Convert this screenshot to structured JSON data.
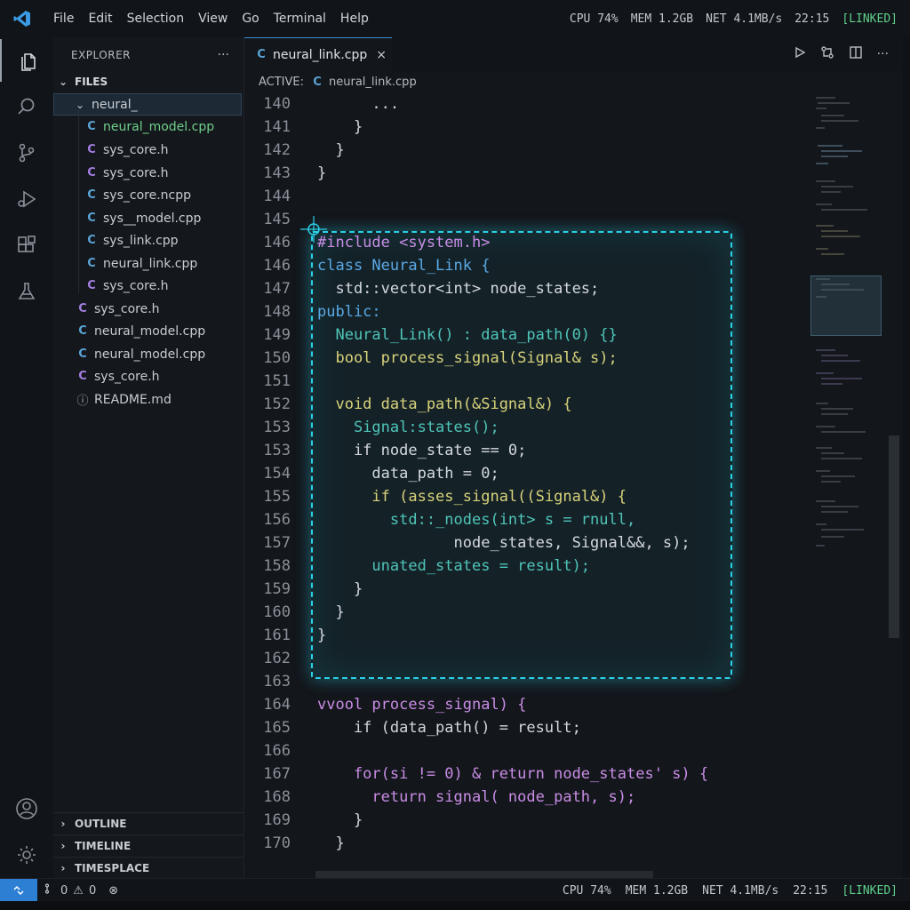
{
  "menubar": {
    "items": [
      "File",
      "Edit",
      "Selection",
      "View",
      "Go",
      "Terminal",
      "Help"
    ]
  },
  "system": {
    "cpu": "CPU 74%",
    "mem": "MEM 1.2GB",
    "net": "NET 4.1MB/s",
    "time": "22:15",
    "link": "[LINKED]"
  },
  "activity_icons": [
    "explorer-icon",
    "search-icon",
    "source-control-icon",
    "run-debug-icon",
    "extensions-icon",
    "flask-icon",
    "account-icon",
    "gear-icon"
  ],
  "explorer": {
    "title": "EXPLORER",
    "more": "···",
    "files_header": "FILES",
    "folder": "neural_",
    "children": [
      {
        "name": "neural_model.cpp",
        "icon": "cpp",
        "modified": true
      },
      {
        "name": "sys_core.h",
        "icon": "c"
      },
      {
        "name": "sys_core.h",
        "icon": "c"
      },
      {
        "name": "sys_core.ncpp",
        "icon": "cpp"
      },
      {
        "name": "sys__model.cpp",
        "icon": "cpp"
      },
      {
        "name": "sys_link.cpp",
        "icon": "cpp"
      },
      {
        "name": "neural_link.cpp",
        "icon": "cpp"
      },
      {
        "name": "sys_core.h",
        "icon": "c"
      }
    ],
    "root_files": [
      {
        "name": "sys_core.h",
        "icon": "c"
      },
      {
        "name": "neural_model.cpp",
        "icon": "cpp"
      },
      {
        "name": "neural_model.cpp",
        "icon": "cpp"
      },
      {
        "name": "sys_core.h",
        "icon": "c"
      },
      {
        "name": "README.md",
        "icon": "info"
      }
    ],
    "panels": [
      "OUTLINE",
      "TIMELINE",
      "TIMESPLACE"
    ]
  },
  "tab": {
    "label": "neural_link.cpp",
    "close": "×"
  },
  "breadcrumb": {
    "prefix": "ACTIVE:",
    "file": "neural_link.cpp"
  },
  "code_lines": [
    {
      "n": "140",
      "t": "      ..."
    },
    {
      "n": "141",
      "t": "    }"
    },
    {
      "n": "142",
      "t": "  }"
    },
    {
      "n": "143",
      "t": "}"
    },
    {
      "n": "144",
      "t": ""
    },
    {
      "n": "145",
      "t": ""
    },
    {
      "n": "146",
      "t": "#include <system.h>"
    },
    {
      "n": "146",
      "t": "class Neural_Link {"
    },
    {
      "n": "147",
      "t": "  std::vector<int> node_states;"
    },
    {
      "n": "148",
      "t": "public:"
    },
    {
      "n": "149",
      "t": "  Neural_Link() : data_path(0) {}"
    },
    {
      "n": "150",
      "t": "  bool process_signal(Signal& s);"
    },
    {
      "n": "151",
      "t": ""
    },
    {
      "n": "152",
      "t": "  void data_path(&Signal&) {"
    },
    {
      "n": "153",
      "t": "    Signal:states();"
    },
    {
      "n": "153",
      "t": "    if node_state == 0;"
    },
    {
      "n": "154",
      "t": "      data_path = 0;"
    },
    {
      "n": "155",
      "t": "      if (asses_signal((Signal&) {"
    },
    {
      "n": "156",
      "t": "        std::_nodes(int> s = rnull,"
    },
    {
      "n": "157",
      "t": "               node_states, Signal&&, s);"
    },
    {
      "n": "158",
      "t": "      unated_states = result);"
    },
    {
      "n": "159",
      "t": "    }"
    },
    {
      "n": "160",
      "t": "  }"
    },
    {
      "n": "161",
      "t": "}"
    },
    {
      "n": "162",
      "t": ""
    },
    {
      "n": "163",
      "t": ""
    },
    {
      "n": "164",
      "t": "vvool process_signal) {"
    },
    {
      "n": "165",
      "t": "    if (data_path() = result;"
    },
    {
      "n": "166",
      "t": ""
    },
    {
      "n": "167",
      "t": "    for(si != 0) & return node_states' s) {"
    },
    {
      "n": "168",
      "t": "      return signal( node_path, s);"
    },
    {
      "n": "169",
      "t": "    }"
    },
    {
      "n": "170",
      "t": "  }"
    }
  ],
  "statusbar": {
    "problems_errors": "0",
    "problems_warnings": "0",
    "cpu": "CPU 74%",
    "mem": "MEM 1.2GB",
    "net": "NET 4.1MB/s",
    "time": "22:15",
    "link": "[LINKED]"
  }
}
